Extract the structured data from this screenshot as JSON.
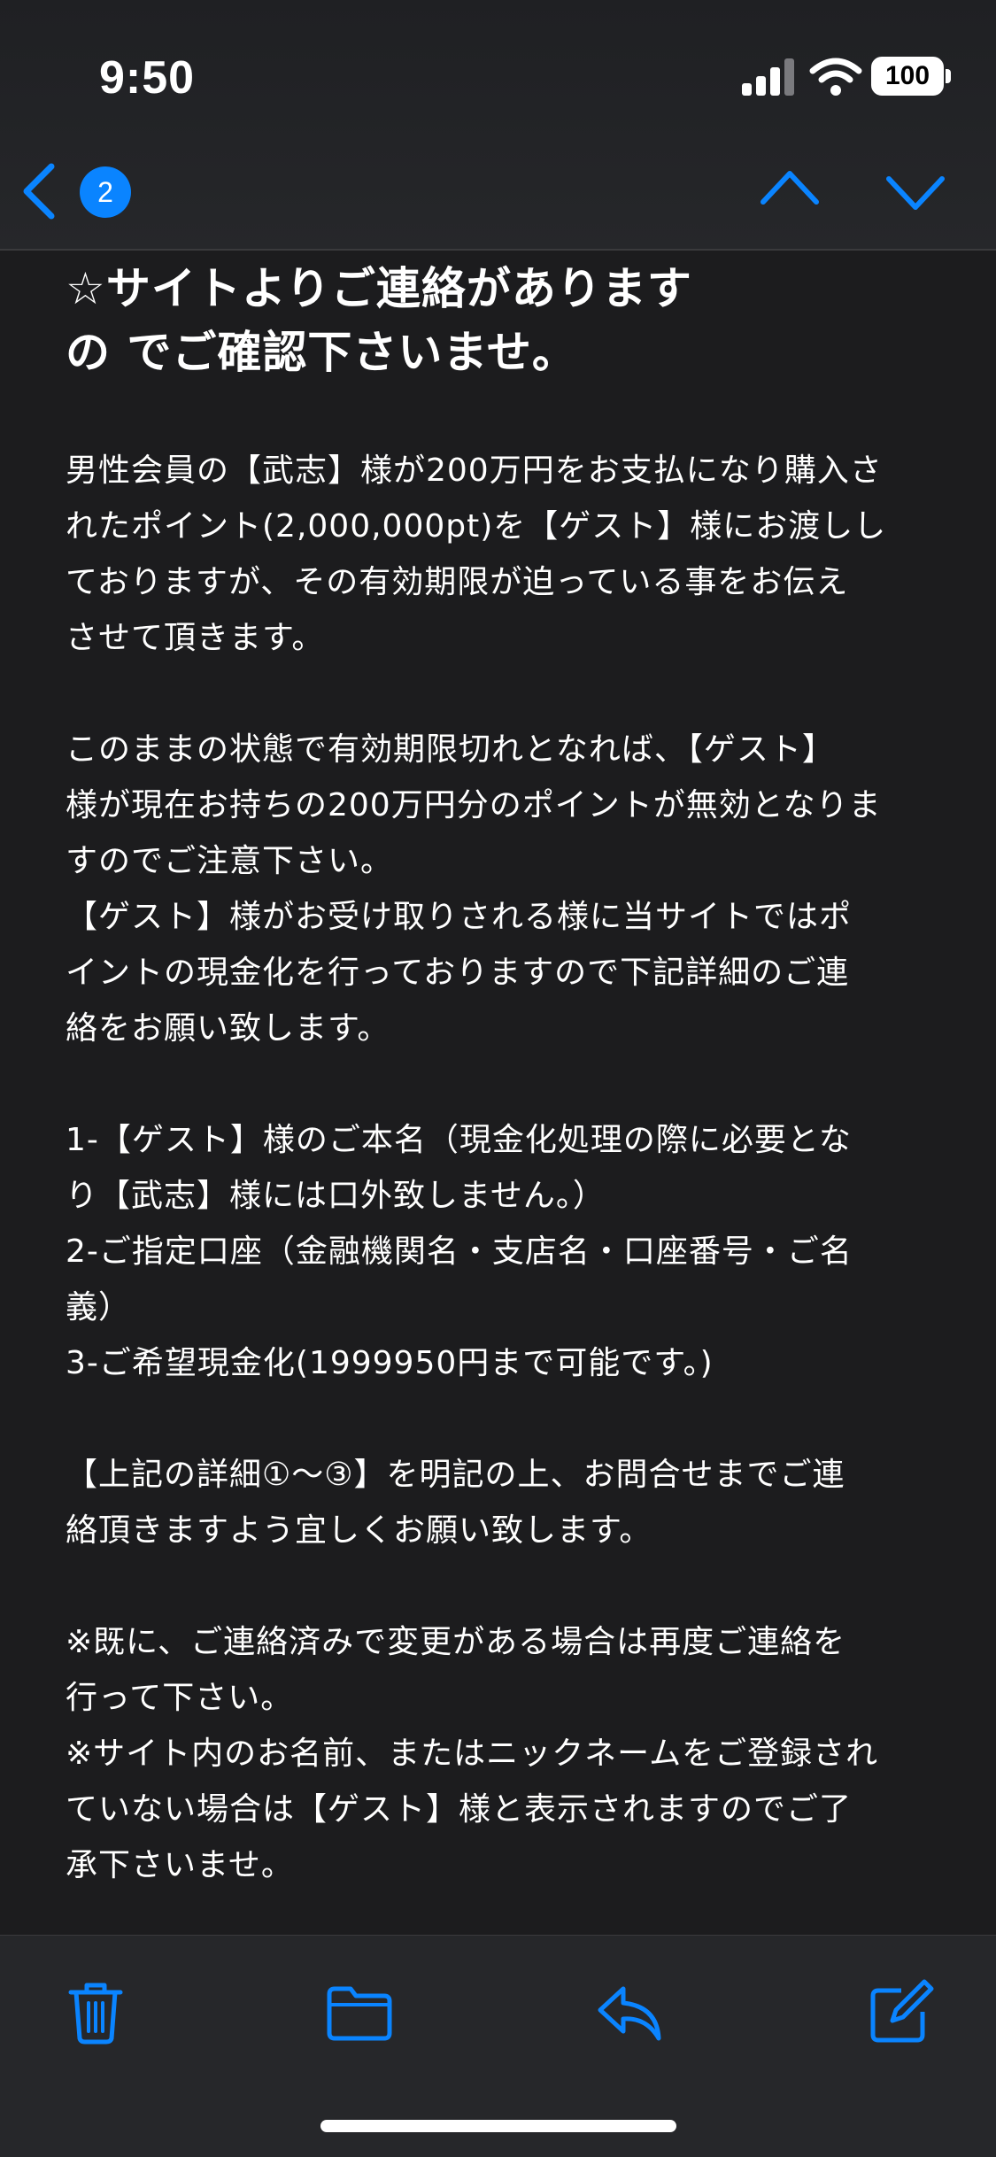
{
  "status_bar": {
    "time": "9:50",
    "battery": "100",
    "signal_icon": "cellular-signal-icon",
    "wifi_icon": "wifi-icon",
    "battery_icon": "battery-icon"
  },
  "nav": {
    "back_icon": "chevron-left-icon",
    "unread_count": "2",
    "up_icon": "chevron-up-icon",
    "down_icon": "chevron-down-icon"
  },
  "email": {
    "subject_lines": [
      "☆サイトよりご連絡があります",
      "の でご確認下さいませ。"
    ],
    "body": {
      "p1": [
        "男性会員の【武志】様が200万円をお支払になり購入さ",
        "れたポイント(2,000,000pt)を【ゲスト】様にお渡しし",
        "ておりますが、その有効期限が迫っている事をお伝え",
        "させて頂きます。"
      ],
      "p2": [
        "このままの状態で有効期限切れとなれば、【ゲスト】",
        "様が現在お持ちの200万円分のポイントが無効となりま",
        "すのでご注意下さい。",
        "【ゲスト】様がお受け取りされる様に当サイトではポ",
        "イントの現金化を行っておりますので下記詳細のご連",
        "絡をお願い致します。"
      ],
      "p3": [
        "1-【ゲスト】様のご本名（現金化処理の際に必要とな",
        "り【武志】様には口外致しません。）",
        "2-ご指定口座（金融機関名・支店名・口座番号・ご名",
        "義）",
        "3-ご希望現金化(1999950円まで可能です。)"
      ],
      "p4": [
        "【上記の詳細①〜③】を明記の上、お問合せまでご連",
        "絡頂きますよう宜しくお願い致します。"
      ],
      "p5": [
        "※既に、ご連絡済みで変更がある場合は再度ご連絡を",
        "行って下さい。",
        "※サイト内のお名前、またはニックネームをご登録され",
        "ていない場合は【ゲスト】様と表示されますのでご了",
        "承下さいませ。"
      ]
    }
  },
  "toolbar": {
    "trash_icon": "trash-icon",
    "folder_icon": "folder-icon",
    "reply_icon": "reply-icon",
    "compose_icon": "compose-icon"
  },
  "colors": {
    "accent": "#0a84ff",
    "background": "#1c1c1e",
    "chrome": "#26272a",
    "text": "#ffffff"
  }
}
